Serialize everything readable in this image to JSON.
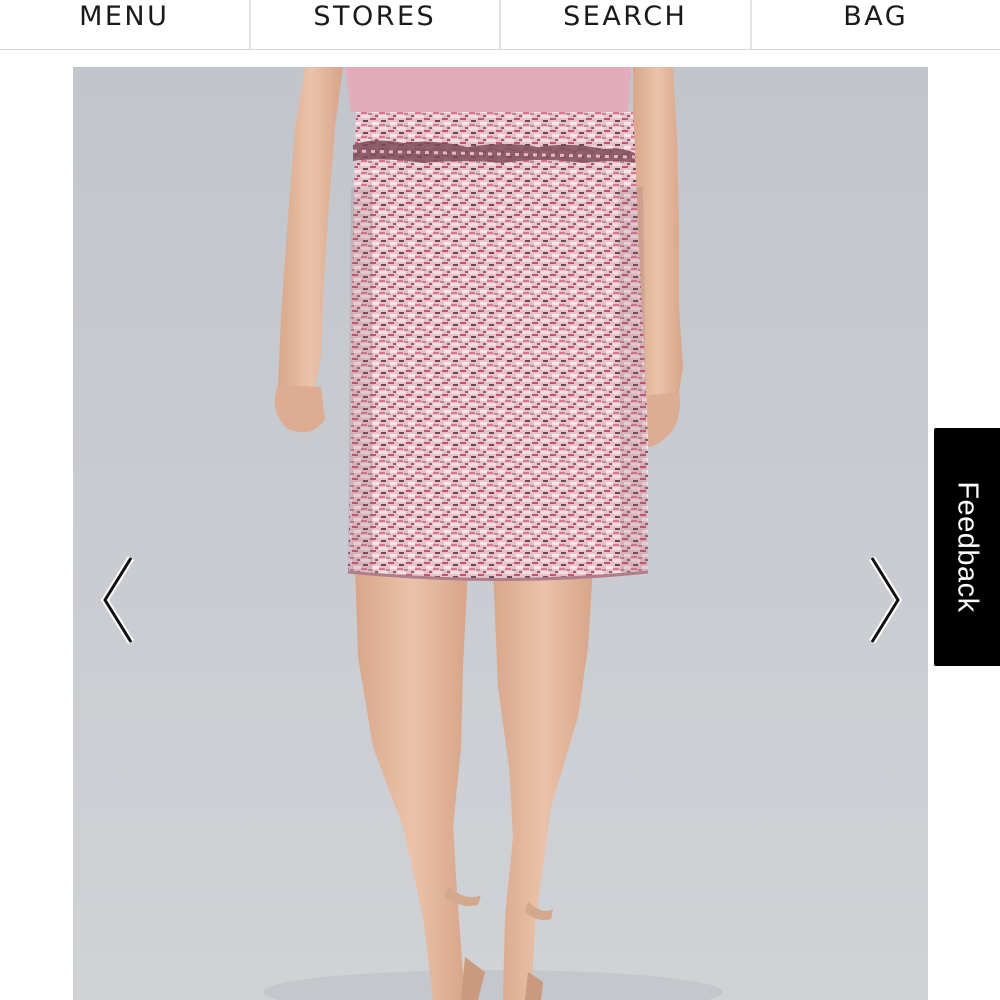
{
  "nav": {
    "items": [
      {
        "label": "MENU"
      },
      {
        "label": "STORES"
      },
      {
        "label": "SEARCH"
      },
      {
        "label": "BAG"
      }
    ]
  },
  "gallery": {
    "prev_icon": "chevron-left-icon",
    "next_icon": "chevron-right-icon",
    "colors": {
      "background": "#c8cacf",
      "skirt_base": "#e6bcc8",
      "skirt_accent": "#d2587d",
      "top": "#e2aab9",
      "skin": "#e6b99f"
    }
  },
  "feedback": {
    "label": "Feedback"
  }
}
